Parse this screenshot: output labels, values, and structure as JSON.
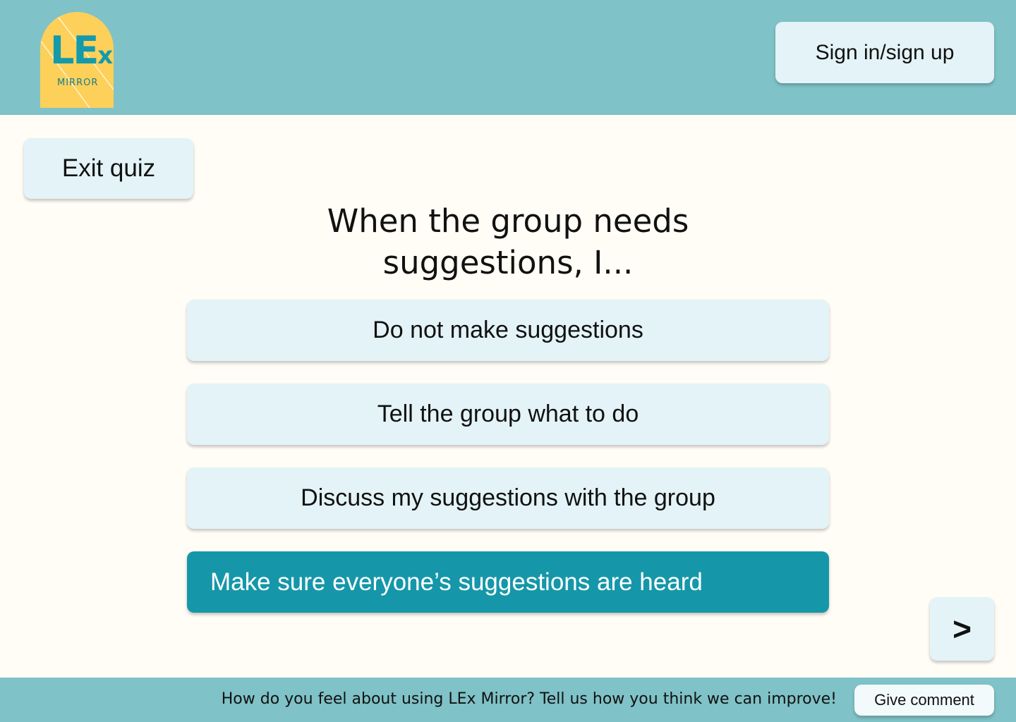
{
  "header": {
    "logo_text": "LE",
    "logo_text_x": "x",
    "logo_sub": "MIRROR",
    "signin_label": "Sign in/sign up"
  },
  "quiz": {
    "exit_label": "Exit quiz",
    "question": "When the group needs suggestions, I...",
    "options": [
      {
        "label": "Do not make suggestions",
        "selected": false
      },
      {
        "label": "Tell the group what to do",
        "selected": false
      },
      {
        "label": "Discuss my suggestions with the group",
        "selected": false
      },
      {
        "label": "Make sure everyone’s suggestions are heard",
        "selected": true
      }
    ],
    "next_label": ">"
  },
  "footer": {
    "prompt": "How do you feel about using LEx Mirror? Tell us how you think we can improve!",
    "comment_label": "Give comment"
  },
  "colors": {
    "header_bg": "#7fc2c7",
    "page_bg": "#fffdf5",
    "button_bg": "#e3f3f7",
    "selected_bg": "#1597a9",
    "logo_bg": "#fdd05a",
    "logo_text": "#139aab"
  }
}
